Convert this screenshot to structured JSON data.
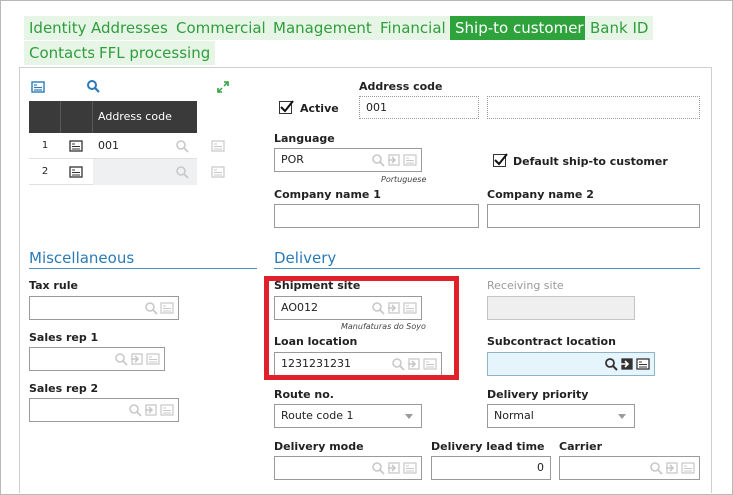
{
  "tabs": [
    {
      "label": "Identity"
    },
    {
      "label": "Addresses"
    },
    {
      "label": "Commercial"
    },
    {
      "label": "Management"
    },
    {
      "label": "Financial"
    },
    {
      "label": "Ship-to customer",
      "active": true
    },
    {
      "label": "Bank ID"
    },
    {
      "label": "Contacts"
    },
    {
      "label": "FFL processing"
    }
  ],
  "grid": {
    "header": "Address code",
    "rows": [
      {
        "num": "1",
        "code": "001"
      },
      {
        "num": "2",
        "code": ""
      }
    ]
  },
  "top": {
    "address_code_label": "Address code",
    "active_label": "Active",
    "address_code_value": "001",
    "address_code_value2": "",
    "language_label": "Language",
    "language_value": "POR",
    "language_desc": "Portuguese",
    "default_shipto_label": "Default ship-to customer",
    "company_name1_label": "Company name 1",
    "company_name1_value": "",
    "company_name2_label": "Company name 2",
    "company_name2_value": ""
  },
  "misc": {
    "title": "Miscellaneous",
    "tax_rule_label": "Tax rule",
    "tax_rule_value": "",
    "sales_rep1_label": "Sales rep 1",
    "sales_rep1_value": "",
    "sales_rep2_label": "Sales rep 2",
    "sales_rep2_value": ""
  },
  "delivery": {
    "title": "Delivery",
    "shipment_site_label": "Shipment site",
    "shipment_site_value": "AO012",
    "shipment_site_desc": "Manufaturas do Soyo",
    "receiving_site_label": "Receiving site",
    "receiving_site_value": "",
    "loan_location_label": "Loan location",
    "loan_location_value": "1231231231",
    "subcontract_location_label": "Subcontract location",
    "subcontract_location_value": "",
    "route_no_label": "Route no.",
    "route_no_value": "Route code 1",
    "delivery_priority_label": "Delivery priority",
    "delivery_priority_value": "Normal",
    "delivery_mode_label": "Delivery mode",
    "delivery_mode_value": "",
    "delivery_lead_time_label": "Delivery lead time",
    "delivery_lead_time_value": "0",
    "carrier_label": "Carrier",
    "carrier_value": ""
  },
  "colors": {
    "tab_text": "#2f9e3c",
    "tab_bg": "#e7f5e7",
    "tab_active_bg": "#2ea33c",
    "section_blue": "#2a7ab8",
    "highlight_red": "#e0202a"
  }
}
